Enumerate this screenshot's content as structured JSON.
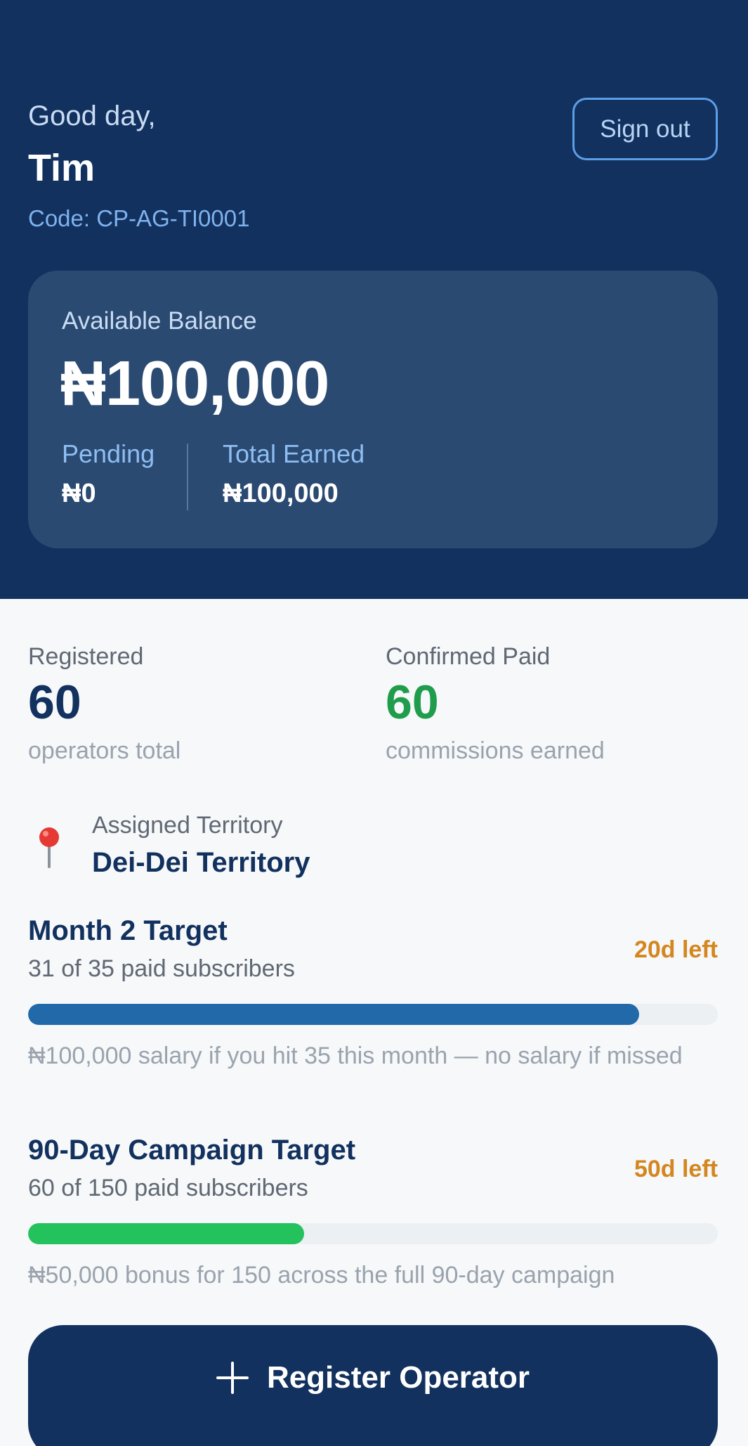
{
  "header": {
    "greeting": "Good day,",
    "name": "Tim",
    "code": "Code: CP-AG-TI0001",
    "signout_label": "Sign out"
  },
  "balance": {
    "label": "Available Balance",
    "amount": "₦100,000",
    "pending_label": "Pending",
    "pending_value": "₦0",
    "earned_label": "Total Earned",
    "earned_value": "₦100,000"
  },
  "stats": {
    "registered": {
      "label": "Registered",
      "value": "60",
      "caption": "operators total"
    },
    "confirmed": {
      "label": "Confirmed Paid",
      "value": "60",
      "caption": "commissions earned"
    }
  },
  "territory": {
    "icon": "map-pin-icon",
    "label": "Assigned Territory",
    "name": "Dei-Dei Territory"
  },
  "targets": {
    "month": {
      "title": "Month 2 Target",
      "subtitle": "31 of 35 paid subscribers",
      "time_left": "20d left",
      "progress": 0.886,
      "note": "₦100,000 salary if you hit 35 this month — no salary if missed"
    },
    "campaign": {
      "title": "90-Day Campaign Target",
      "subtitle": "60 of 150 paid subscribers",
      "time_left": "50d left",
      "progress": 0.4,
      "note": "₦50,000 bonus for 150 across the full 90-day campaign"
    }
  },
  "cta": {
    "icon": "plus-icon",
    "label": "Register Operator"
  },
  "colors": {
    "primary": "#12315e",
    "card": "#2a4a72",
    "accent_blue": "#2169a9",
    "success": "#1f9d4c",
    "progress_green": "#24c25c",
    "warning": "#d4861f"
  }
}
